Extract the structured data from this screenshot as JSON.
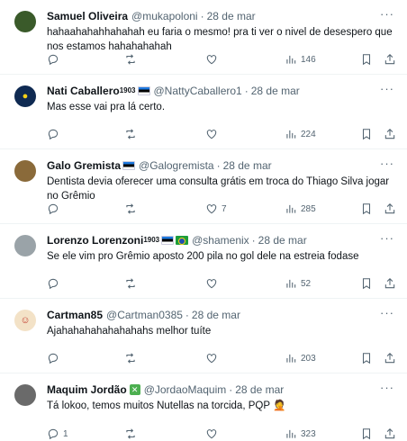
{
  "tweets": [
    {
      "name": "Samuel Oliveira",
      "handle": "@mukapoloni",
      "time": "28 de mar",
      "text": "hahaahahahhahahah eu faria o mesmo! pra ti ver o nivel de desespero que nos estamos hahahahahah",
      "replies": "",
      "likes": "",
      "views": "146",
      "avatar_color": "#3a5a2a"
    },
    {
      "name": "Nati Caballero",
      "badge": "1903",
      "handle": "@NattyCaballero1",
      "time": "28 de mar",
      "text": "Mas esse vai pra lá certo.",
      "replies": "",
      "likes": "",
      "views": "224",
      "avatar_color": "#0f2a52"
    },
    {
      "name": "Galo Gremista",
      "handle": "@Galogremista",
      "time": "28 de mar",
      "text": "Dentista devia oferecer uma consulta grátis em troca do Thiago Silva jogar no Grêmio",
      "replies": "",
      "likes": "7",
      "views": "285",
      "avatar_color": "#8a6a3a"
    },
    {
      "name": "Lorenzo Lorenzoni",
      "badge": "1903",
      "handle": "@shamenix",
      "time": "28 de mar",
      "text": "Se ele vim pro Grêmio aposto 200 pila no gol dele na estreia fodase",
      "replies": "",
      "likes": "",
      "views": "52",
      "avatar_color": "#9aa3a8"
    },
    {
      "name": "Cartman85",
      "handle": "@Cartman0385",
      "time": "28 de mar",
      "text": "Ajahahahahahahahahs melhor tuíte",
      "replies": "",
      "likes": "",
      "views": "203",
      "avatar_color": "#c0392b"
    },
    {
      "name": "Maquim Jordão",
      "handle": "@JordaoMaquim",
      "time": "28 de mar",
      "text": "Tá lokoo, temos muitos Nutellas na torcida, PQP 🤦",
      "replies": "1",
      "likes": "",
      "views": "323",
      "avatar_color": "#6a6a6a"
    }
  ],
  "icons": {
    "more": "more-icon",
    "reply": "reply-icon",
    "retweet": "retweet-icon",
    "like": "like-icon",
    "views": "views-icon",
    "bookmark": "bookmark-icon",
    "share": "share-icon"
  }
}
